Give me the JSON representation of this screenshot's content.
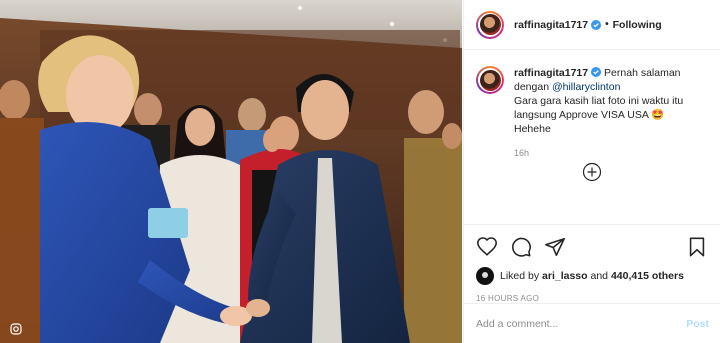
{
  "post": {
    "username": "raffinagita1717",
    "separator": "•",
    "follow_label": "Following",
    "caption_part1": "Pernah salaman dengan ",
    "caption_mention": "@hillaryclinton",
    "caption_line2": "Gara gara kasih liat foto ini waktu itu langsung Approve VISA USA 🤩",
    "caption_line3": "Hehehe",
    "caption_time": "16h"
  },
  "engagement": {
    "liked_by_prefix": "Liked by ",
    "liked_by_user": "ari_lasso",
    "liked_by_and": " and ",
    "likes_count": "440,415 others",
    "time_ago": "16 HOURS AGO"
  },
  "comment": {
    "placeholder": "Add a comment...",
    "post_label": "Post"
  },
  "icons": {
    "verified": "verified-badge-icon",
    "like": "heart-icon",
    "comment": "comment-bubble-icon",
    "share": "paper-plane-icon",
    "save": "bookmark-icon",
    "more": "plus-circle-icon"
  },
  "colors": {
    "verified_blue": "#3897f0",
    "mention": "#00376b",
    "muted": "#8e8e8e",
    "post_disabled": "#b2dffc"
  }
}
